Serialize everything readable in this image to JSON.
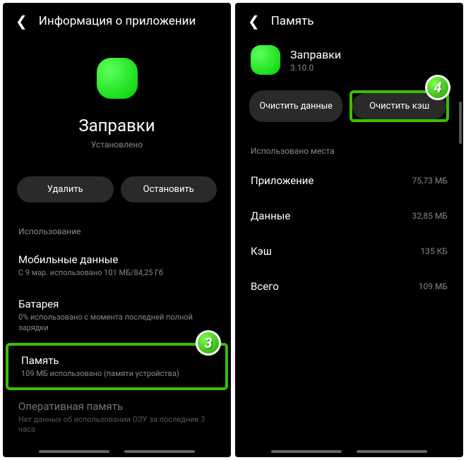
{
  "left": {
    "header": "Информация о приложении",
    "app_name": "Заправки",
    "status": "Установлено",
    "btn_uninstall": "Удалить",
    "btn_stop": "Остановить",
    "section": "Использование",
    "items": {
      "mobile": {
        "title": "Мобильные данные",
        "sub": "С 9 мар. использовано 101 МБ/84,25 Гб"
      },
      "battery": {
        "title": "Батарея",
        "sub": "0% использовано с момента последней полной зарядки"
      },
      "memory": {
        "title": "Память",
        "sub": "109 МБ использовано (памяти устройства)"
      },
      "ram": {
        "title": "Оперативная память",
        "sub": "Нет данных об использовании ОЗУ за последние 3 часа"
      }
    },
    "badge": "3"
  },
  "right": {
    "header": "Память",
    "app_name": "Заправки",
    "version": "3.10.0",
    "btn_data": "Очистить данные",
    "btn_cache": "Очистить кэш",
    "section": "Использовано места",
    "rows": {
      "app": {
        "label": "Приложение",
        "value": "75,73 МБ"
      },
      "data": {
        "label": "Данные",
        "value": "32,85 МБ"
      },
      "cache": {
        "label": "Кэш",
        "value": "135 КБ"
      },
      "total": {
        "label": "Всего",
        "value": "109 МБ"
      }
    },
    "badge": "4"
  }
}
